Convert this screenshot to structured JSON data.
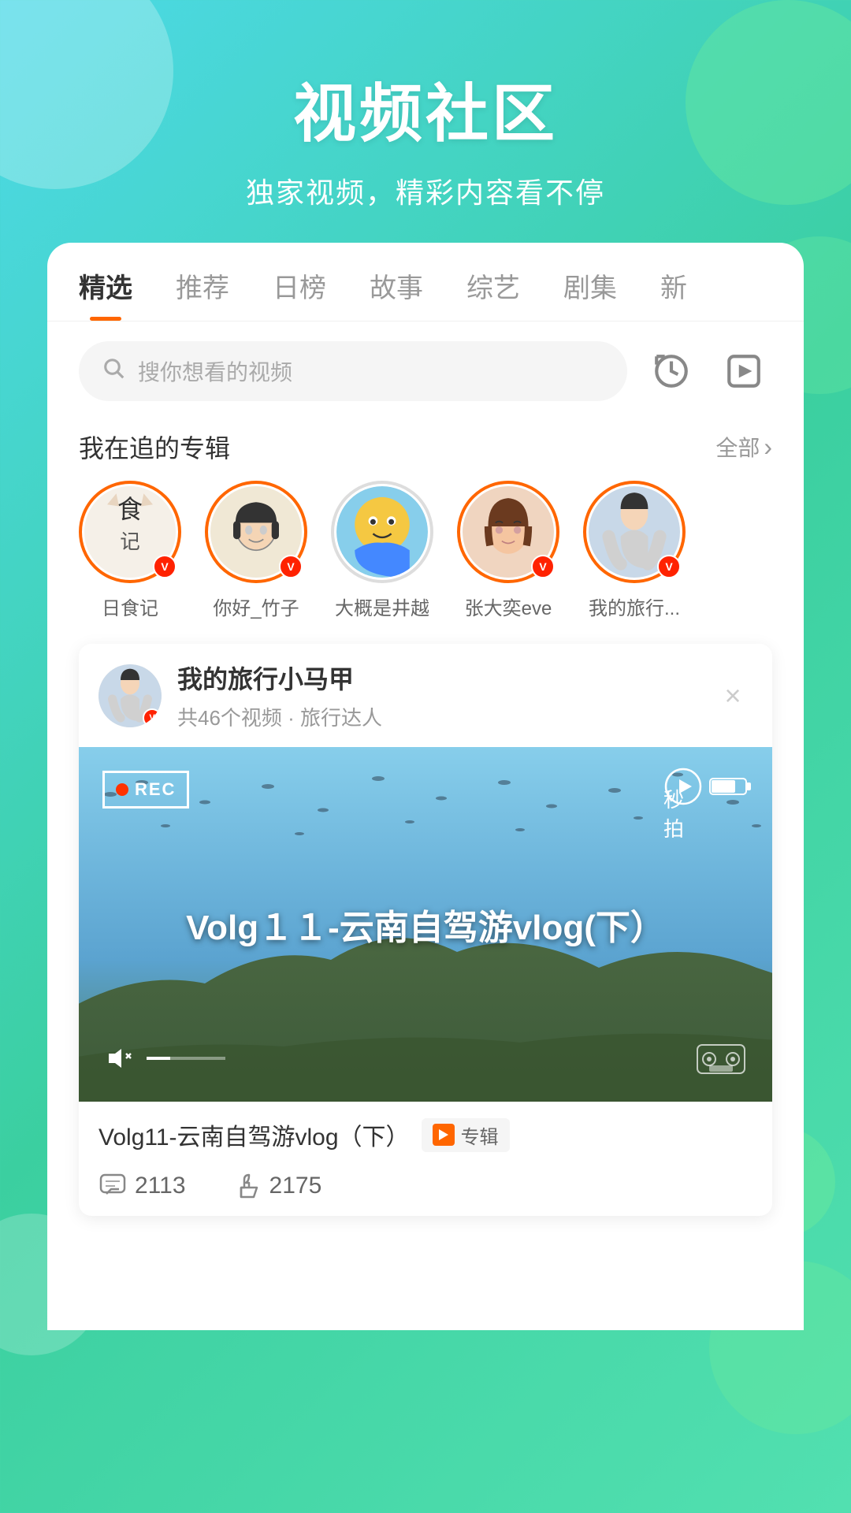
{
  "header": {
    "title": "视频社区",
    "subtitle": "独家视频，精彩内容看不停"
  },
  "tabs": {
    "items": [
      {
        "label": "精选",
        "active": true
      },
      {
        "label": "推荐",
        "active": false
      },
      {
        "label": "日榜",
        "active": false
      },
      {
        "label": "故事",
        "active": false
      },
      {
        "label": "综艺",
        "active": false
      },
      {
        "label": "剧集",
        "active": false
      },
      {
        "label": "新",
        "active": false
      }
    ]
  },
  "search": {
    "placeholder": "搜你想看的视频"
  },
  "subscriptions": {
    "section_title": "我在追的专辑",
    "more_label": "全部",
    "items": [
      {
        "name": "日食记",
        "has_badge": true
      },
      {
        "name": "你好_竹子",
        "has_badge": true
      },
      {
        "name": "大概是井越",
        "has_badge": false
      },
      {
        "name": "张大奕eve",
        "has_badge": true
      },
      {
        "name": "我的旅行...",
        "has_badge": true
      }
    ]
  },
  "featured": {
    "channel_name": "我的旅行小马甲",
    "meta": "共46个视频 · 旅行达人",
    "video_title": "Volg11-云南自驾游vlog（下）",
    "video_overlay_title": "Volg１１-云南自驾游vlog(下）",
    "tag_label": "专辑",
    "stats": {
      "comments": "2113",
      "likes": "2175"
    }
  },
  "icons": {
    "search": "🔍",
    "history": "⏱",
    "playlist": "▶",
    "chevron_right": "›",
    "comment": "💬",
    "like": "👍",
    "close": "×",
    "volume": "🔇"
  },
  "colors": {
    "accent": "#ff6600",
    "tab_active": "#333333",
    "tab_inactive": "#999999",
    "card_bg": "#ffffff",
    "gradient_start": "#4dd9e8",
    "gradient_end": "#3bcfa0"
  }
}
